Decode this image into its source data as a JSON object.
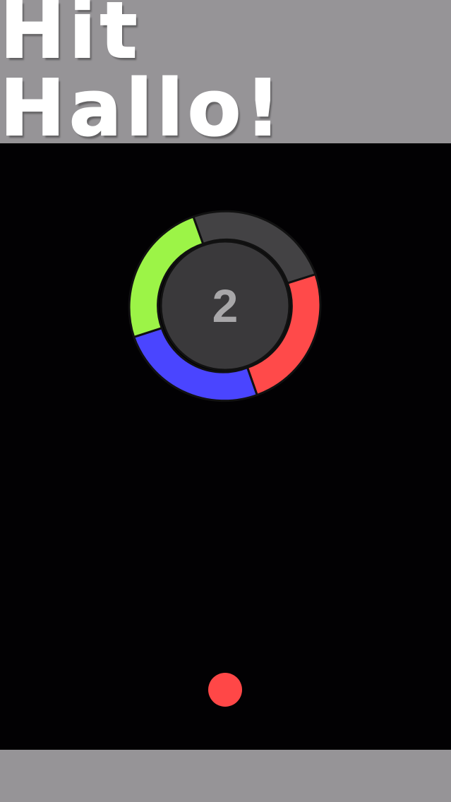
{
  "header": {
    "title": "Hit Hallo!"
  },
  "wheel": {
    "count": "2",
    "segments": [
      {
        "name": "gray",
        "color": "#434244"
      },
      {
        "name": "red",
        "color": "#ff4a4a"
      },
      {
        "name": "blue",
        "color": "#4a45ff"
      },
      {
        "name": "green",
        "color": "#9cf447"
      }
    ],
    "center_color": "#3a393b",
    "count_color": "#a8a7a9"
  },
  "ball": {
    "color": "#ff4747"
  },
  "colors": {
    "banner": "#969497",
    "background": "#020103",
    "title": "#ffffff"
  }
}
